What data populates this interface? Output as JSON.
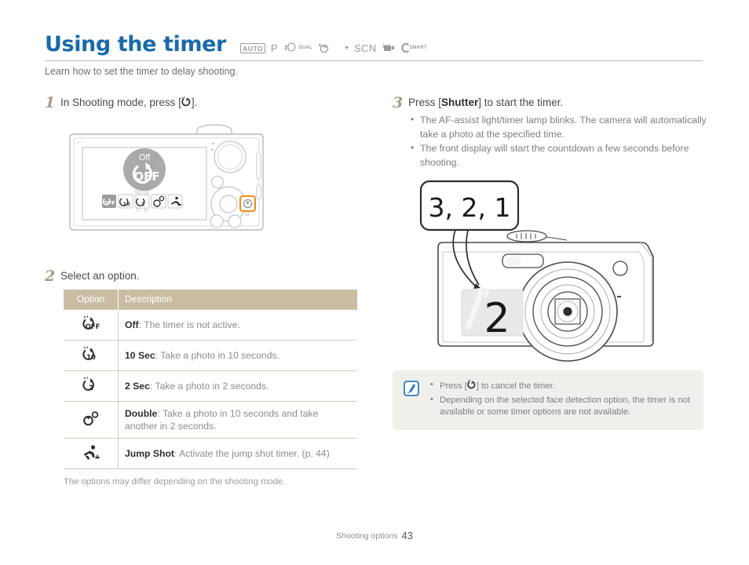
{
  "header": {
    "title": "Using the timer",
    "subtitle": "Learn how to set the timer to delay shooting.",
    "mode_icons": [
      {
        "name": "auto-mode-icon",
        "label": "AUTO"
      },
      {
        "name": "program-mode-icon",
        "label": "P"
      },
      {
        "name": "dual-is-mode-icon",
        "label": "DUAL"
      },
      {
        "name": "night-mode-icon",
        "label": ""
      },
      {
        "name": "beauty-shot-mode-icon",
        "label": ""
      },
      {
        "name": "scene-mode-icon",
        "label": "SCN"
      },
      {
        "name": "movie-mode-icon",
        "label": ""
      },
      {
        "name": "smart-auto-mode-icon",
        "label": "SMART"
      }
    ]
  },
  "steps": [
    {
      "num": "1",
      "title_prefix": "In Shooting mode, press [",
      "title_suffix": "].",
      "bracket_icon": "timer-icon"
    },
    {
      "num": "2",
      "title": "Select an option."
    },
    {
      "num": "3",
      "title_prefix": "Press [",
      "title_bold": "Shutter",
      "title_suffix": "] to start the timer.",
      "bullets": [
        "The AF-assist light/timer lamp blinks. The camera will automatically take a photo at the specified time.",
        "The front display will start the countdown a few seconds before shooting."
      ]
    }
  ],
  "camera_back": {
    "lcd_label": "Off",
    "lcd_big_glyph": "OFF",
    "option_icons": [
      "timer-off-icon",
      "timer-10sec-icon",
      "timer-2sec-icon",
      "timer-double-icon",
      "jump-shot-icon"
    ],
    "highlighted_button": "timer-button"
  },
  "camera_front": {
    "callout_text": "3, 2, 1",
    "front_display_value": "2"
  },
  "table": {
    "columns": [
      "Option",
      "Description"
    ],
    "rows": [
      {
        "icon": "timer-off-icon",
        "icon_glyph": "OFF",
        "term": "Off",
        "desc": ": The timer is not active."
      },
      {
        "icon": "timer-10sec-icon",
        "icon_glyph": "10",
        "term": "10 Sec",
        "desc": ": Take a photo in 10 seconds."
      },
      {
        "icon": "timer-2sec-icon",
        "icon_glyph": "2",
        "term": "2 Sec",
        "desc": ": Take a photo in 2 seconds."
      },
      {
        "icon": "timer-double-icon",
        "icon_glyph": "",
        "term": "Double",
        "desc": ": Take a photo in 10 seconds and take another in 2 seconds."
      },
      {
        "icon": "jump-shot-icon",
        "icon_glyph": "",
        "term": "Jump Shot",
        "desc": ": Activate the jump shot timer. (p. 44)"
      }
    ],
    "footnote": "The options may differ depending on the shooting mode."
  },
  "note": {
    "icon": "note-pen-icon",
    "bullets": [
      {
        "prefix": "Press [",
        "icon": "timer-icon",
        "suffix": "] to cancel the timer."
      },
      {
        "prefix": "",
        "icon": "",
        "suffix": "Depending on the selected face detection option, the timer is not available or some timer options are not available."
      }
    ]
  },
  "footer": {
    "section": "Shooting options",
    "page": "43"
  },
  "colors": {
    "title_blue": "#1a6aab",
    "table_header": "#c9bda4",
    "note_bg": "#f0efeb",
    "step_num": "#a99c86",
    "highlight_orange": "#f08a1e"
  }
}
